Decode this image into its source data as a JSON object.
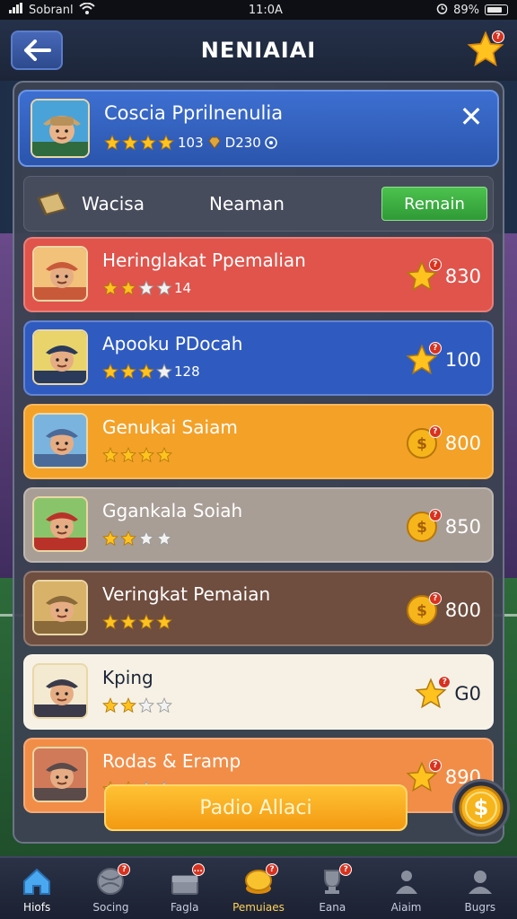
{
  "status_bar": {
    "carrier": "Sobranl",
    "time": "11:0A",
    "battery": "89%"
  },
  "header": {
    "title": "NENIAIAI",
    "back_icon": "arrow-left-icon",
    "star_badge": "?"
  },
  "profile": {
    "name": "Coscia Pprilnenulia",
    "stat_a": "103",
    "stat_b": "D230",
    "close_icon": "close-icon"
  },
  "filter": {
    "tab1": "Wacisa",
    "tab2": "Neaman",
    "button": "Remain"
  },
  "rows": [
    {
      "name": "Heringlakat Ppemalian",
      "stars_text": "14",
      "reward": "830",
      "color": "#e0544c",
      "reward_icon": "star-icon",
      "stars": 2
    },
    {
      "name": "Apooku PDocah",
      "stars_text": "128",
      "reward": "100",
      "color": "#2f5bc0",
      "reward_icon": "star-icon",
      "stars": 3
    },
    {
      "name": "Genukai Saiam",
      "stars_text": "",
      "reward": "800",
      "color": "#f4a128",
      "reward_icon": "coin-icon",
      "stars": 4
    },
    {
      "name": "Ggankala Soiah",
      "stars_text": "",
      "reward": "850",
      "color": "#a89e96",
      "reward_icon": "coin-icon",
      "stars": 2
    },
    {
      "name": "Veringkat Pemaian",
      "stars_text": "",
      "reward": "800",
      "color": "#6f4e3f",
      "reward_icon": "coin-icon",
      "stars": 4
    },
    {
      "name": "Kping",
      "stars_text": "",
      "reward": "G0",
      "color": "#f6f1e4",
      "reward_icon": "star-icon",
      "stars": 2
    },
    {
      "name": "Rodas & Eramp",
      "stars_text": "",
      "reward": "890",
      "color": "#f28d48",
      "reward_icon": "star-icon",
      "stars": 2
    }
  ],
  "cta_button": "Padio Allaci",
  "fab_icon": "dollar-coin-icon",
  "bottom_nav": [
    {
      "label": "Hiofs",
      "icon": "home-icon"
    },
    {
      "label": "Socing",
      "icon": "ball-icon",
      "badge": "?"
    },
    {
      "label": "Fagla",
      "icon": "chest-icon",
      "badge": "..."
    },
    {
      "label": "Pemuiaes",
      "icon": "coin-stack-icon",
      "badge": "?"
    },
    {
      "label": "Eana",
      "icon": "trophy-icon",
      "badge": "?"
    },
    {
      "label": "Aiaim",
      "icon": "people-icon"
    },
    {
      "label": "Bugrs",
      "icon": "profile-icon"
    }
  ]
}
